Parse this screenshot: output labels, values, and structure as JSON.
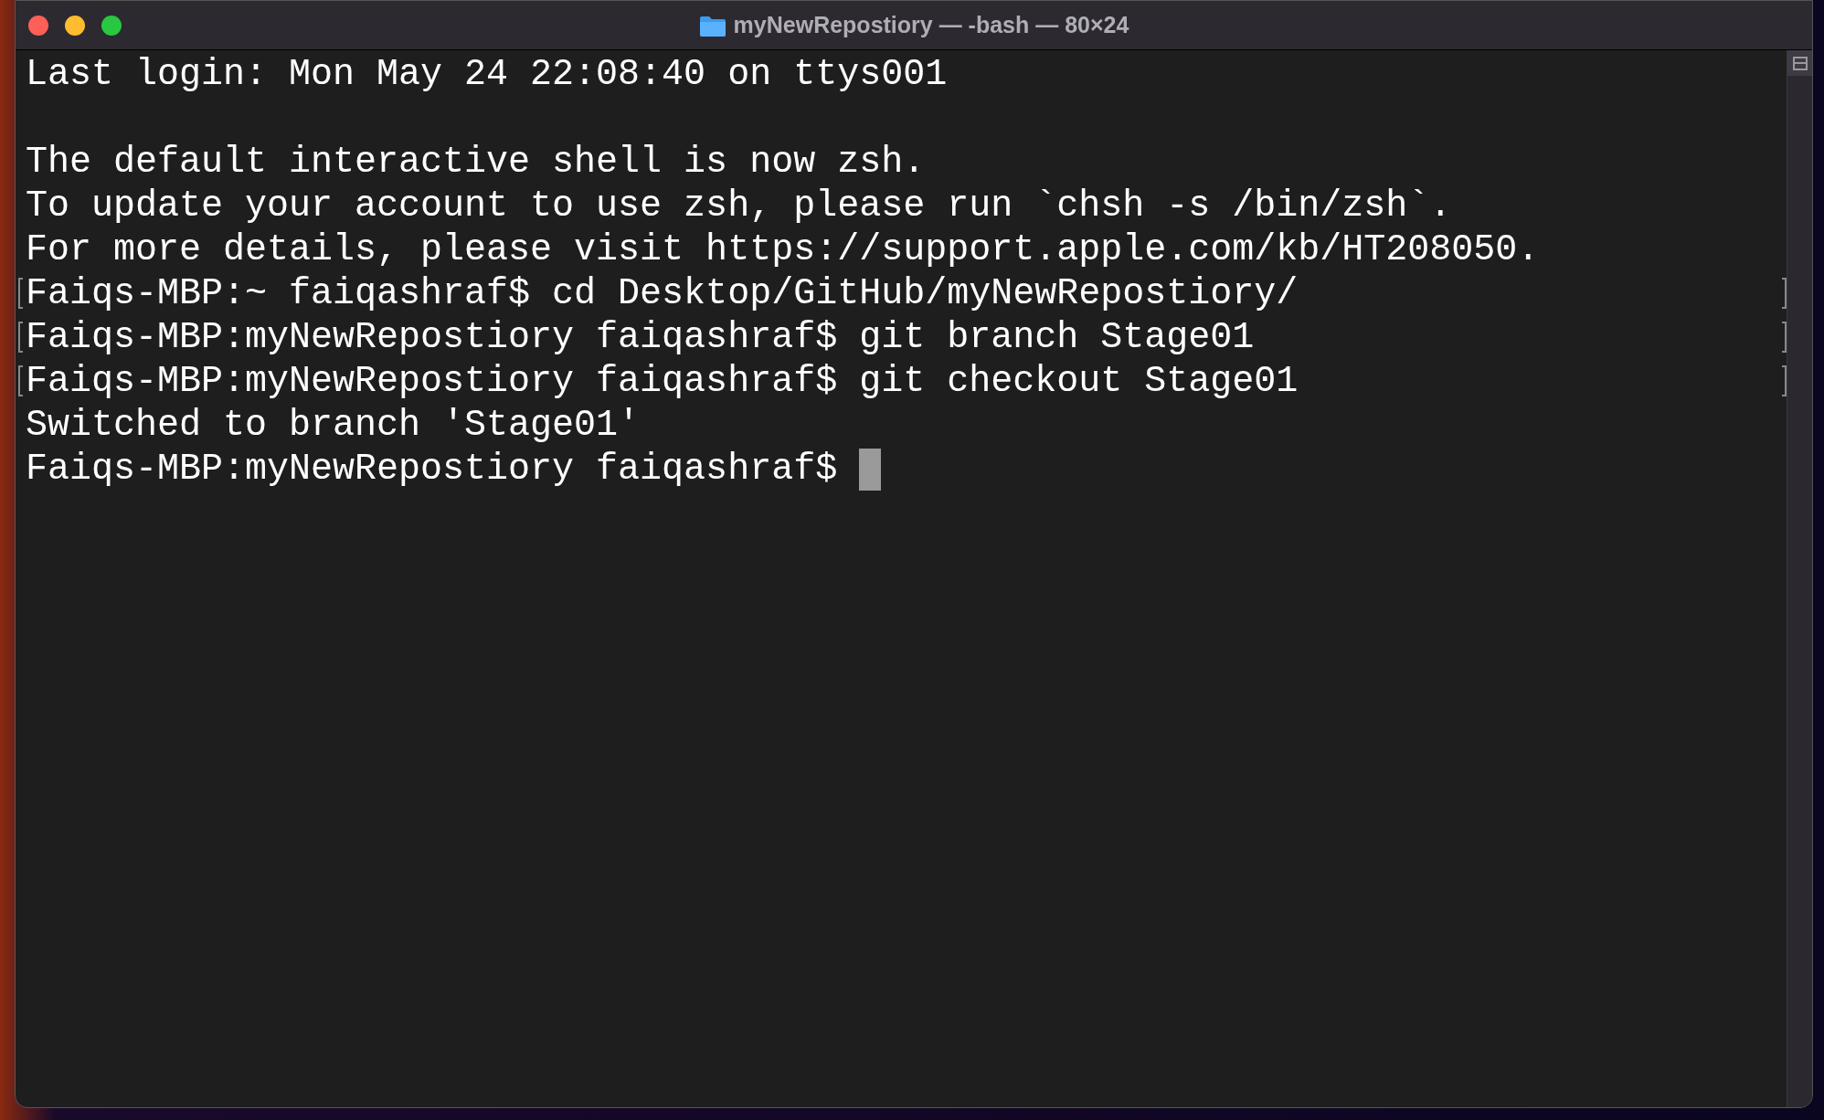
{
  "window": {
    "title": "myNewRepostiory — -bash — 80×24"
  },
  "terminal": {
    "lines": [
      {
        "text": "Last login: Mon May 24 22:08:40 on ttys001",
        "marked": false,
        "cursor": false
      },
      {
        "marked": false,
        "cursor": false
      },
      {
        "text": "The default interactive shell is now zsh.",
        "marked": false,
        "cursor": false
      },
      {
        "text": "To update your account to use zsh, please run `chsh -s /bin/zsh`.",
        "marked": false,
        "cursor": false
      },
      {
        "text": "For more details, please visit https://support.apple.com/kb/HT208050.",
        "marked": false,
        "cursor": false
      },
      {
        "text": "Faiqs-MBP:~ faiqashraf$ cd Desktop/GitHub/myNewRepostiory/",
        "marked": true,
        "cursor": false
      },
      {
        "text": "Faiqs-MBP:myNewRepostiory faiqashraf$ git branch Stage01",
        "marked": true,
        "cursor": false
      },
      {
        "text": "Faiqs-MBP:myNewRepostiory faiqashraf$ git checkout Stage01",
        "marked": true,
        "cursor": false
      },
      {
        "text": "Switched to branch 'Stage01'",
        "marked": false,
        "cursor": false
      },
      {
        "text": "Faiqs-MBP:myNewRepostiory faiqashraf$ ",
        "marked": false,
        "cursor": true
      }
    ]
  }
}
